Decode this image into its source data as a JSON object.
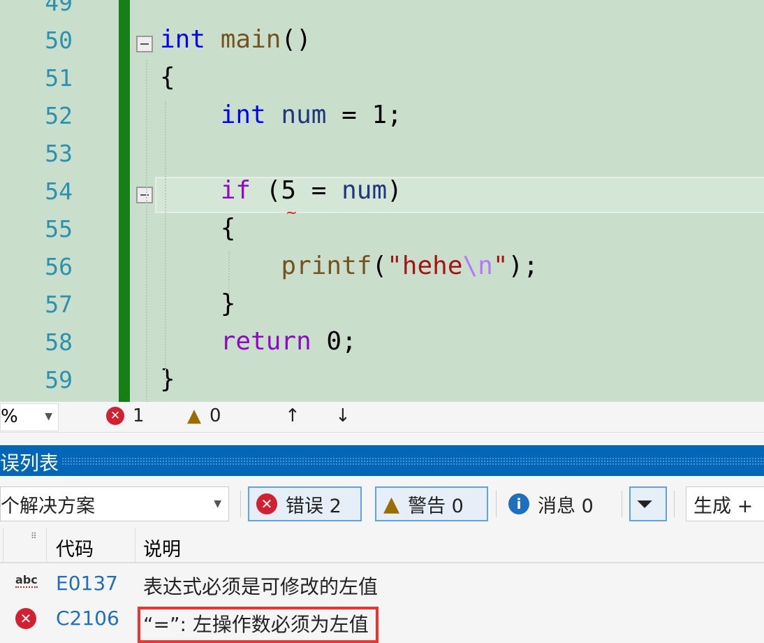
{
  "editor": {
    "lines": [
      {
        "n": "49",
        "tokens": []
      },
      {
        "n": "50",
        "tokens": [
          {
            "t": "int",
            "c": "#0000ff"
          },
          {
            "t": " "
          },
          {
            "t": "main",
            "c": "#74531f"
          },
          {
            "t": "()"
          }
        ]
      },
      {
        "n": "51",
        "tokens": [
          {
            "t": "{"
          }
        ]
      },
      {
        "n": "52",
        "tokens": [
          {
            "t": "    "
          },
          {
            "t": "int",
            "c": "#0000ff"
          },
          {
            "t": " "
          },
          {
            "t": "num",
            "c": "#1f377f"
          },
          {
            "t": " = 1;"
          }
        ]
      },
      {
        "n": "53",
        "tokens": []
      },
      {
        "n": "54",
        "tokens": [
          {
            "t": "    "
          },
          {
            "t": "if",
            "c": "#8f08c4"
          },
          {
            "t": " (5 = "
          },
          {
            "t": "num",
            "c": "#1f377f"
          },
          {
            "t": ")"
          }
        ]
      },
      {
        "n": "55",
        "tokens": [
          {
            "t": "    {"
          }
        ]
      },
      {
        "n": "56",
        "tokens": [
          {
            "t": "        "
          },
          {
            "t": "printf",
            "c": "#74531f"
          },
          {
            "t": "("
          },
          {
            "t": "\"hehe",
            "c": "#a31515"
          },
          {
            "t": "\\n",
            "c": "#b776fb"
          },
          {
            "t": "\"",
            "c": "#a31515"
          },
          {
            "t": ");"
          }
        ]
      },
      {
        "n": "57",
        "tokens": [
          {
            "t": "    }"
          }
        ]
      },
      {
        "n": "58",
        "tokens": [
          {
            "t": "    "
          },
          {
            "t": "return",
            "c": "#8f08c4"
          },
          {
            "t": " 0;"
          }
        ]
      },
      {
        "n": "59",
        "tokens": [
          {
            "t": "}"
          }
        ]
      }
    ]
  },
  "status": {
    "zoom": "%",
    "errors": "1",
    "warnings": "0",
    "up_icon": "arrow-up",
    "down_icon": "arrow-down"
  },
  "panel": {
    "title": "误列表",
    "scope": "个解决方案",
    "errors_btn": "错误 2",
    "warnings_btn": "警告 0",
    "messages_btn": "消息 0",
    "build": "生成 +",
    "columns": {
      "code": "代码",
      "desc": "说明"
    },
    "rows": [
      {
        "icon": "spell-check-icon",
        "code": "E0137",
        "desc": "表达式必须是可修改的左值"
      },
      {
        "icon": "error-icon",
        "code": "C2106",
        "desc": "“=”: 左操作数必须为左值"
      }
    ]
  },
  "colors": {
    "accent": "#0066b8",
    "error": "#d1202f",
    "warning": "#9a6d00",
    "info": "#1e6fc0",
    "highlight": "#ee3333"
  }
}
